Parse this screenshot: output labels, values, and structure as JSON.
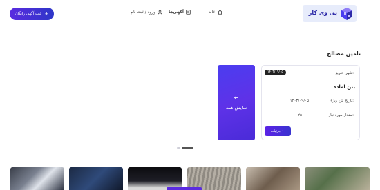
{
  "header": {
    "logo_text": "پی وی کار",
    "nav": {
      "home": "خانه",
      "ads": "آگهی‌ها",
      "login": "ورود / ثبت نام"
    },
    "cta_label": "ثبت آگهی رایگان",
    "cta_icon": "plus-icon"
  },
  "section": {
    "title": "تامین مصالح",
    "card": {
      "city_label": "شهر:",
      "city_value": "تبریز",
      "date_badge": "۱۴۰۳/۰۹/۰۵",
      "title": "بتن آماده",
      "pour_date_label": "تاریخ بتن ریزی:",
      "pour_date_value": "۱۴۰۳/۰۹/۰۵",
      "qty_label": "مقدار مورد نیاز:",
      "qty_value": "۲۵",
      "details_label": "جزئیات ←"
    },
    "show_all": {
      "arrow": "←",
      "label": "نمایش همه"
    }
  },
  "colors": {
    "brand": "#5a2be0",
    "brand_dark": "#2d2aa8",
    "logo_bg": "#e7ecfb"
  }
}
